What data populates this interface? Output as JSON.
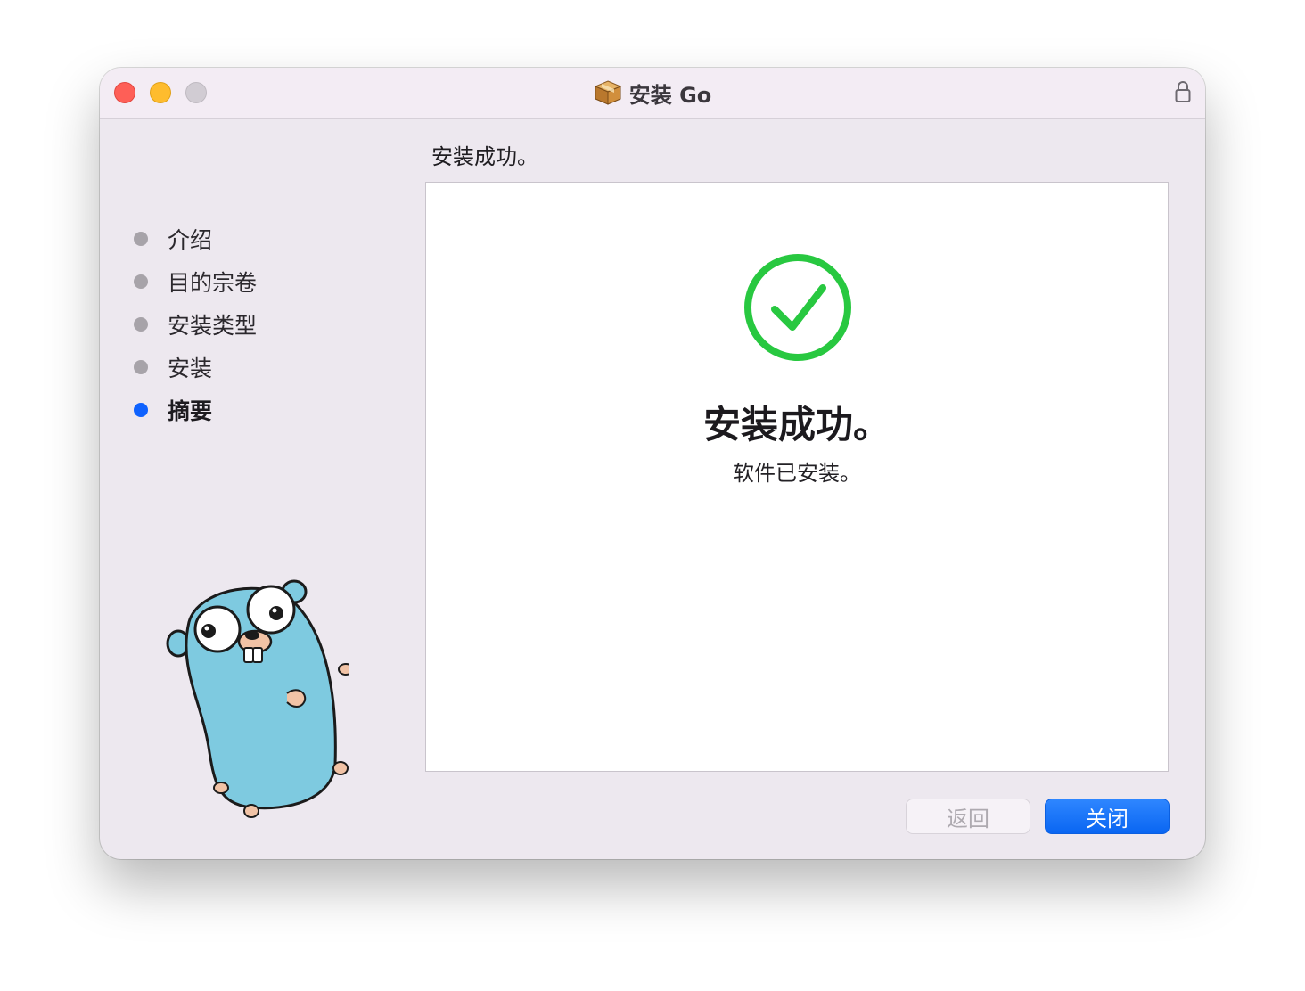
{
  "window": {
    "title": "安装 Go"
  },
  "sidebar": {
    "steps": [
      {
        "label": "介绍",
        "state": "done"
      },
      {
        "label": "目的宗卷",
        "state": "done"
      },
      {
        "label": "安装类型",
        "state": "done"
      },
      {
        "label": "安装",
        "state": "done"
      },
      {
        "label": "摘要",
        "state": "current"
      }
    ]
  },
  "main": {
    "heading": "安装成功。",
    "status_title": "安装成功。",
    "status_subtitle": "软件已安装。"
  },
  "buttons": {
    "back_label": "返回",
    "close_label": "关闭"
  },
  "colors": {
    "success_green": "#28c840",
    "accent_blue": "#0f62fe",
    "gopher_blue": "#7ecae0"
  },
  "icons": {
    "window_icon": "package-icon",
    "lock_icon": "lock-icon",
    "status_icon": "checkmark-circle-icon",
    "mascot": "gopher-mascot"
  }
}
